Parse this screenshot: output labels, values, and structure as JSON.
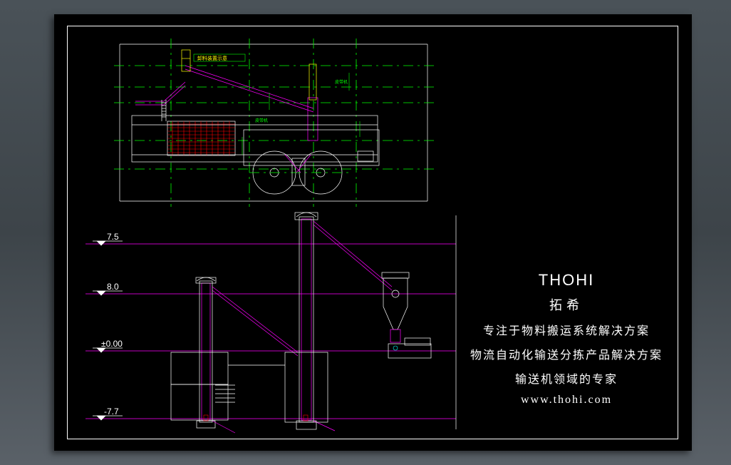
{
  "company": {
    "name_en": "THOHI",
    "name_cn": "拓希",
    "slogan1": "专注于物料搬运系统解决方案",
    "slogan2": "物流自动化输送分拣产品解决方案",
    "slogan3": "输送机领域的专家",
    "website": "www.thohi.com"
  },
  "elevations": {
    "e1": "7.5",
    "e2": "8.0",
    "e3": "±0.00",
    "e4": "-7.7"
  },
  "top_view_labels": {
    "lbl1": "卸料装置示意",
    "lbl2": "皮带机",
    "lbl3": "皮带机"
  }
}
